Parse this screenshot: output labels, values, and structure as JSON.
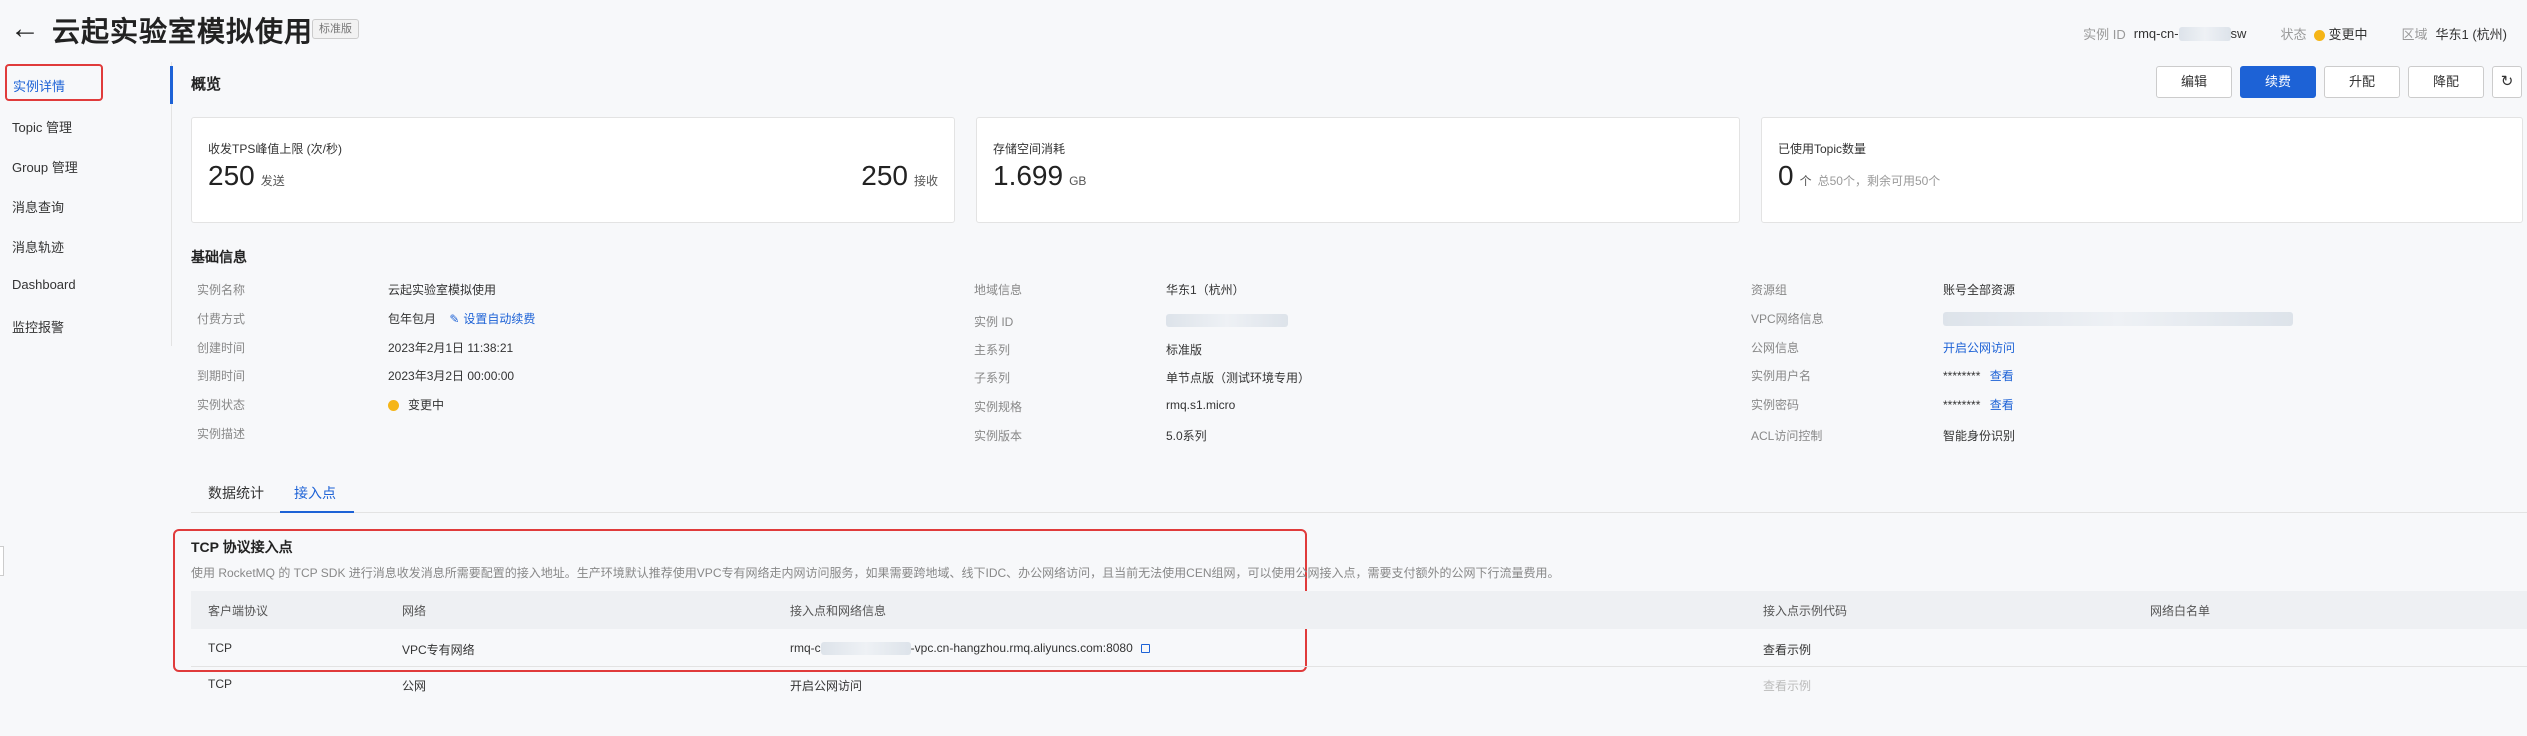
{
  "header": {
    "back_icon": "arrow-left-icon",
    "title": "云起实验室模拟使用",
    "badge": "标准版",
    "instance_id_label": "实例 ID",
    "instance_id_value": "rmq-cn-",
    "instance_id_suffix": "sw",
    "status_label": "状态",
    "status_value": "变更中",
    "region_label": "区域",
    "region_value": "华东1 (杭州)"
  },
  "sidebar": {
    "items": [
      {
        "label": "实例详情"
      },
      {
        "label": "Topic 管理"
      },
      {
        "label": "Group 管理"
      },
      {
        "label": "消息查询"
      },
      {
        "label": "消息轨迹"
      },
      {
        "label": "Dashboard"
      },
      {
        "label": "监控报警"
      }
    ]
  },
  "overview": {
    "title": "概览",
    "buttons": {
      "edit": "编辑",
      "renew": "续费",
      "upgrade": "升配",
      "downgrade": "降配",
      "refresh_icon": "refresh-icon"
    },
    "cards": {
      "tps": {
        "label": "收发TPS峰值上限 (次/秒)",
        "send_value": "250",
        "send_unit": "发送",
        "recv_value": "250",
        "recv_unit": "接收"
      },
      "storage": {
        "label": "存储空间消耗",
        "value": "1.699",
        "unit": "GB"
      },
      "topics": {
        "label": "已使用Topic数量",
        "value": "0",
        "unit": "个",
        "note": "总50个，剩余可用50个"
      }
    }
  },
  "basic_info": {
    "title": "基础信息",
    "col1": {
      "name_label": "实例名称",
      "name_value": "云起实验室模拟使用",
      "pay_label": "付费方式",
      "pay_value": "包年包月",
      "auto_renew": "设置自动续费",
      "created_label": "创建时间",
      "created_value": "2023年2月1日 11:38:21",
      "expire_label": "到期时间",
      "expire_value": "2023年3月2日 00:00:00",
      "status_label": "实例状态",
      "status_value": "变更中",
      "desc_label": "实例描述"
    },
    "col2": {
      "region_label": "地域信息",
      "region_value": "华东1（杭州）",
      "id_label": "实例 ID",
      "series_label": "主系列",
      "series_value": "标准版",
      "subseries_label": "子系列",
      "subseries_value": "单节点版（测试环境专用）",
      "spec_label": "实例规格",
      "spec_value": "rmq.s1.micro",
      "version_label": "实例版本",
      "version_value": "5.0系列"
    },
    "col3": {
      "rg_label": "资源组",
      "rg_value": "账号全部资源",
      "vpc_label": "VPC网络信息",
      "public_label": "公网信息",
      "public_value": "开启公网访问",
      "user_label": "实例用户名",
      "user_value": "********",
      "user_view": "查看",
      "pwd_label": "实例密码",
      "pwd_value": "********",
      "pwd_view": "查看",
      "acl_label": "ACL访问控制",
      "acl_value": "智能身份识别"
    }
  },
  "tabs": [
    {
      "label": "数据统计"
    },
    {
      "label": "接入点"
    }
  ],
  "tcp": {
    "title": "TCP 协议接入点",
    "desc": "使用 RocketMQ 的 TCP SDK 进行消息收发消息所需要配置的接入地址。生产环境默认推荐使用VPC专有网络走内网访问服务，如果需要跨地域、线下IDC、办公网络访问，且当前无法使用CEN组网，可以使用公网接入点，需要支付额外的公网下行流量费用。",
    "headers": [
      "客户端协议",
      "网络",
      "接入点和网络信息",
      "接入点示例代码",
      "网络白名单"
    ],
    "rows": [
      {
        "protocol": "TCP",
        "network": "VPC专有网络",
        "endpoint_prefix": "rmq-c",
        "endpoint_suffix": "-vpc.cn-hangzhou.rmq.aliyuncs.com:8080",
        "example": "查看示例"
      },
      {
        "protocol": "TCP",
        "network": "公网",
        "endpoint": "开启公网访问",
        "example": "查看示例"
      }
    ]
  },
  "colors": {
    "accent": "#1d62d6",
    "highlight": "#e03b3b",
    "status_yellow": "#f5b517"
  }
}
